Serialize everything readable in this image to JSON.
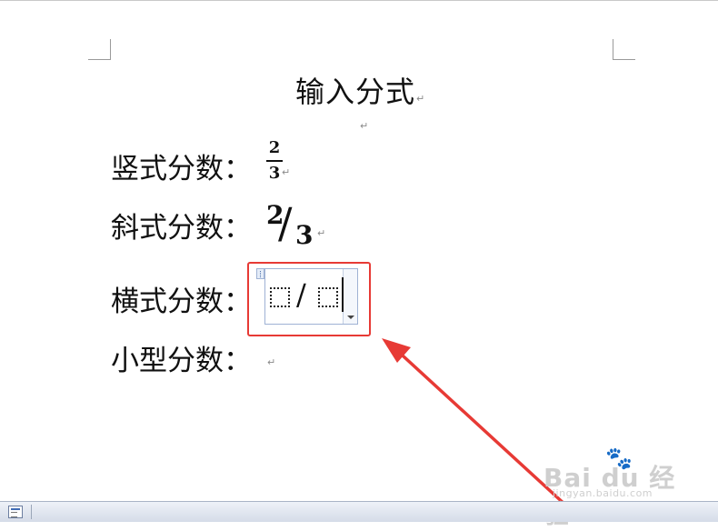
{
  "document": {
    "title": "输入分式",
    "paragraph_mark": "↵",
    "lines": [
      {
        "label": "竖式分数："
      },
      {
        "label": "斜式分数："
      },
      {
        "label": "横式分数："
      },
      {
        "label": "小型分数："
      }
    ],
    "stacked_fraction": {
      "numerator": "2",
      "denominator": "3"
    },
    "skewed_fraction": {
      "numerator": "2",
      "slash": "/",
      "denominator": "3"
    },
    "linear_fraction_editor": {
      "slash": "/"
    }
  },
  "annotation": {
    "color": "#e73a35"
  },
  "watermark": {
    "brand": "Bai du 经验",
    "paw": "🐾",
    "url": "jingyan.baidu.com"
  },
  "statusbar": {
    "icon": "page-view-icon"
  }
}
